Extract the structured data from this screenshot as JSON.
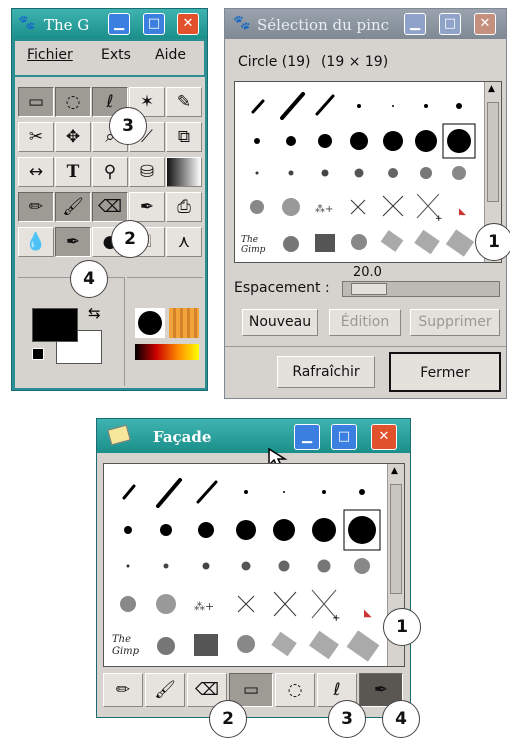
{
  "toolbox": {
    "title": "The G",
    "menu": [
      "Fichier",
      "Exts",
      "Aide"
    ],
    "tools_row1": [
      "rect-select",
      "ellipse-select",
      "lasso",
      "fuzzy-select",
      "paths"
    ],
    "tools_row2": [
      "scissors",
      "move",
      "zoom",
      "measure",
      "crop"
    ],
    "tools_row3": [
      "flip",
      "text",
      "color-picker",
      "bucket-fill",
      "gradient"
    ],
    "tools_row4": [
      "pencil",
      "paintbrush",
      "eraser",
      "airbrush",
      "clone"
    ],
    "tools_row5": [
      "blur",
      "ink",
      "dodge",
      "smudge",
      "perspective"
    ],
    "swap_glyph": "⇆"
  },
  "brush_dialog": {
    "title": "Sélection du pinc",
    "brush_name": "Circle (19)",
    "brush_size": "(19 × 19)",
    "spacing_value": "20.0",
    "spacing_label": "Espacement :",
    "buttons": {
      "new": "Nouveau",
      "edit": "Édition",
      "delete": "Supprimer",
      "refresh": "Rafraîchir",
      "close": "Fermer"
    }
  },
  "facade": {
    "title": "Façade"
  },
  "callouts": {
    "top_1": "1",
    "top_2": "2",
    "top_3": "3",
    "top_4": "4",
    "bot_1": "1",
    "bot_2": "2",
    "bot_3": "3",
    "bot_4": "4"
  },
  "icons": {
    "min": "▁",
    "max": "□",
    "close": "✕",
    "gimp": "🐾",
    "scroll_up": "▲"
  }
}
